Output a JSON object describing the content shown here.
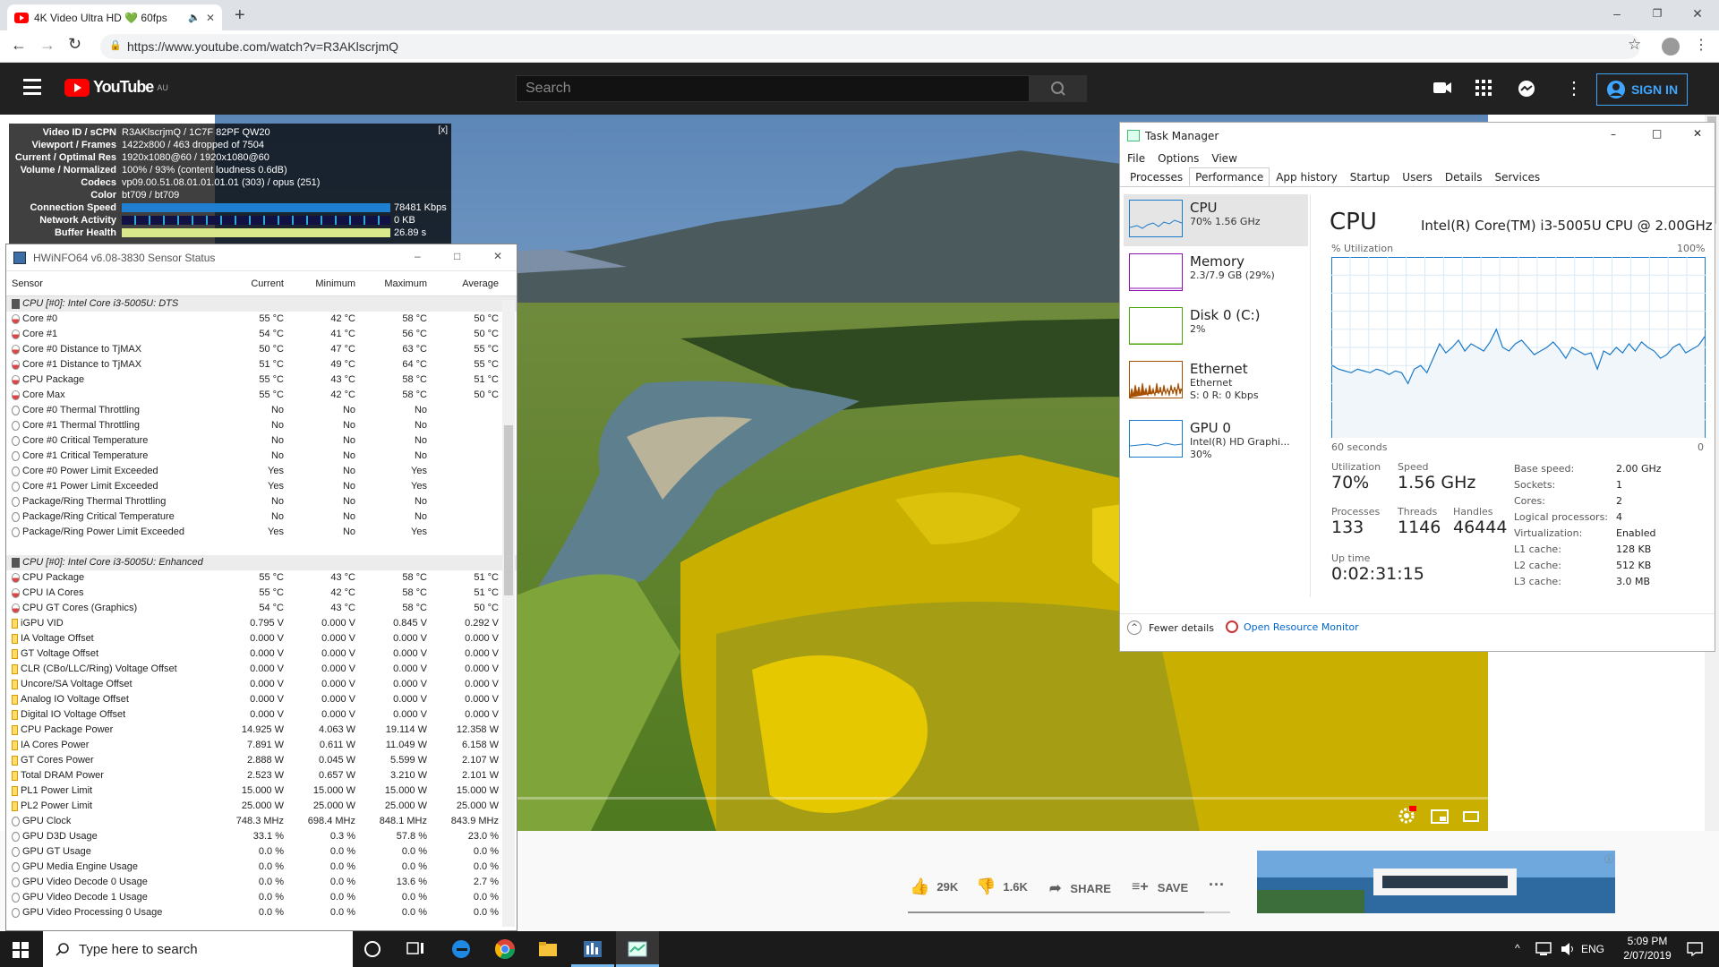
{
  "browser": {
    "tab_title": "4K Video Ultra HD 💚 60fps",
    "url": "https://www.youtube.com/watch?v=R3AKlscrjmQ"
  },
  "youtube": {
    "logo": "YouTube",
    "region": "AU",
    "search_placeholder": "Search",
    "signin_label": "SIGN IN",
    "likes": "29K",
    "dislikes": "1.6K",
    "share_label": "SHARE",
    "save_label": "SAVE"
  },
  "stats_for_nerds": {
    "close": "[x]",
    "rows": [
      {
        "k": "Video ID / sCPN",
        "v": "R3AKlscrjmQ / 1C7F 82PF QW20"
      },
      {
        "k": "Viewport / Frames",
        "v": "1422x800 / 463 dropped of 7504"
      },
      {
        "k": "Current / Optimal Res",
        "v": "1920x1080@60 / 1920x1080@60"
      },
      {
        "k": "Volume / Normalized",
        "v": "100% / 93% (content loudness 0.6dB)"
      },
      {
        "k": "Codecs",
        "v": "vp09.00.51.08.01.01.01.01 (303) / opus (251)"
      },
      {
        "k": "Color",
        "v": "bt709 / bt709"
      },
      {
        "k": "Connection Speed",
        "v": "78481 Kbps"
      },
      {
        "k": "Network Activity",
        "v": "0 KB"
      },
      {
        "k": "Buffer Health",
        "v": "26.89 s"
      }
    ]
  },
  "hwinfo": {
    "title": "HWiNFO64 v6.08-3830 Sensor Status",
    "headers": [
      "Sensor",
      "Current",
      "Minimum",
      "Maximum",
      "Average"
    ],
    "rows": [
      {
        "grp": true,
        "n": "CPU [#0]: Intel Core i3-5005U: DTS"
      },
      {
        "i": "t",
        "n": "Core #0",
        "c": "55 °C",
        "mn": "42 °C",
        "mx": "58 °C",
        "av": "50 °C"
      },
      {
        "i": "t",
        "n": "Core #1",
        "c": "54 °C",
        "mn": "41 °C",
        "mx": "56 °C",
        "av": "50 °C"
      },
      {
        "i": "t",
        "n": "Core #0 Distance to TjMAX",
        "c": "50 °C",
        "mn": "47 °C",
        "mx": "63 °C",
        "av": "55 °C"
      },
      {
        "i": "t",
        "n": "Core #1 Distance to TjMAX",
        "c": "51 °C",
        "mn": "49 °C",
        "mx": "64 °C",
        "av": "55 °C"
      },
      {
        "i": "t",
        "n": "CPU Package",
        "c": "55 °C",
        "mn": "43 °C",
        "mx": "58 °C",
        "av": "51 °C"
      },
      {
        "i": "t",
        "n": "Core Max",
        "c": "55 °C",
        "mn": "42 °C",
        "mx": "58 °C",
        "av": "50 °C"
      },
      {
        "i": "o",
        "n": "Core #0 Thermal Throttling",
        "c": "No",
        "mn": "No",
        "mx": "No",
        "av": ""
      },
      {
        "i": "o",
        "n": "Core #1 Thermal Throttling",
        "c": "No",
        "mn": "No",
        "mx": "No",
        "av": ""
      },
      {
        "i": "o",
        "n": "Core #0 Critical Temperature",
        "c": "No",
        "mn": "No",
        "mx": "No",
        "av": ""
      },
      {
        "i": "o",
        "n": "Core #1 Critical Temperature",
        "c": "No",
        "mn": "No",
        "mx": "No",
        "av": ""
      },
      {
        "i": "o",
        "n": "Core #0 Power Limit Exceeded",
        "c": "Yes",
        "mn": "No",
        "mx": "Yes",
        "av": ""
      },
      {
        "i": "o",
        "n": "Core #1 Power Limit Exceeded",
        "c": "Yes",
        "mn": "No",
        "mx": "Yes",
        "av": ""
      },
      {
        "i": "o",
        "n": "Package/Ring Thermal Throttling",
        "c": "No",
        "mn": "No",
        "mx": "No",
        "av": ""
      },
      {
        "i": "o",
        "n": "Package/Ring Critical Temperature",
        "c": "No",
        "mn": "No",
        "mx": "No",
        "av": ""
      },
      {
        "i": "o",
        "n": "Package/Ring Power Limit Exceeded",
        "c": "Yes",
        "mn": "No",
        "mx": "Yes",
        "av": ""
      },
      {
        "blank": true
      },
      {
        "grp": true,
        "n": "CPU [#0]: Intel Core i3-5005U: Enhanced"
      },
      {
        "i": "t",
        "n": "CPU Package",
        "c": "55 °C",
        "mn": "43 °C",
        "mx": "58 °C",
        "av": "51 °C"
      },
      {
        "i": "t",
        "n": "CPU IA Cores",
        "c": "55 °C",
        "mn": "42 °C",
        "mx": "58 °C",
        "av": "51 °C"
      },
      {
        "i": "t",
        "n": "CPU GT Cores (Graphics)",
        "c": "54 °C",
        "mn": "43 °C",
        "mx": "58 °C",
        "av": "50 °C"
      },
      {
        "i": "v",
        "n": "iGPU VID",
        "c": "0.795 V",
        "mn": "0.000 V",
        "mx": "0.845 V",
        "av": "0.292 V"
      },
      {
        "i": "v",
        "n": "IA Voltage Offset",
        "c": "0.000 V",
        "mn": "0.000 V",
        "mx": "0.000 V",
        "av": "0.000 V"
      },
      {
        "i": "v",
        "n": "GT Voltage Offset",
        "c": "0.000 V",
        "mn": "0.000 V",
        "mx": "0.000 V",
        "av": "0.000 V"
      },
      {
        "i": "v",
        "n": "CLR (CBo/LLC/Ring) Voltage Offset",
        "c": "0.000 V",
        "mn": "0.000 V",
        "mx": "0.000 V",
        "av": "0.000 V"
      },
      {
        "i": "v",
        "n": "Uncore/SA Voltage Offset",
        "c": "0.000 V",
        "mn": "0.000 V",
        "mx": "0.000 V",
        "av": "0.000 V"
      },
      {
        "i": "v",
        "n": "Analog IO Voltage Offset",
        "c": "0.000 V",
        "mn": "0.000 V",
        "mx": "0.000 V",
        "av": "0.000 V"
      },
      {
        "i": "v",
        "n": "Digital IO Voltage Offset",
        "c": "0.000 V",
        "mn": "0.000 V",
        "mx": "0.000 V",
        "av": "0.000 V"
      },
      {
        "i": "v",
        "n": "CPU Package Power",
        "c": "14.925 W",
        "mn": "4.063 W",
        "mx": "19.114 W",
        "av": "12.358 W"
      },
      {
        "i": "v",
        "n": "IA Cores Power",
        "c": "7.891 W",
        "mn": "0.611 W",
        "mx": "11.049 W",
        "av": "6.158 W"
      },
      {
        "i": "v",
        "n": "GT Cores Power",
        "c": "2.888 W",
        "mn": "0.045 W",
        "mx": "5.599 W",
        "av": "2.107 W"
      },
      {
        "i": "v",
        "n": "Total DRAM Power",
        "c": "2.523 W",
        "mn": "0.657 W",
        "mx": "3.210 W",
        "av": "2.101 W"
      },
      {
        "i": "v",
        "n": "PL1 Power Limit",
        "c": "15.000 W",
        "mn": "15.000 W",
        "mx": "15.000 W",
        "av": "15.000 W"
      },
      {
        "i": "v",
        "n": "PL2 Power Limit",
        "c": "25.000 W",
        "mn": "25.000 W",
        "mx": "25.000 W",
        "av": "25.000 W"
      },
      {
        "i": "o",
        "n": "GPU Clock",
        "c": "748.3 MHz",
        "mn": "698.4 MHz",
        "mx": "848.1 MHz",
        "av": "843.9 MHz"
      },
      {
        "i": "o",
        "n": "GPU D3D Usage",
        "c": "33.1 %",
        "mn": "0.3 %",
        "mx": "57.8 %",
        "av": "23.0 %"
      },
      {
        "i": "o",
        "n": "GPU GT Usage",
        "c": "0.0 %",
        "mn": "0.0 %",
        "mx": "0.0 %",
        "av": "0.0 %"
      },
      {
        "i": "o",
        "n": "GPU Media Engine Usage",
        "c": "0.0 %",
        "mn": "0.0 %",
        "mx": "0.0 %",
        "av": "0.0 %"
      },
      {
        "i": "o",
        "n": "GPU Video Decode 0 Usage",
        "c": "0.0 %",
        "mn": "0.0 %",
        "mx": "13.6 %",
        "av": "2.7 %"
      },
      {
        "i": "o",
        "n": "GPU Video Decode 1 Usage",
        "c": "0.0 %",
        "mn": "0.0 %",
        "mx": "0.0 %",
        "av": "0.0 %"
      },
      {
        "i": "o",
        "n": "GPU Video Processing 0 Usage",
        "c": "0.0 %",
        "mn": "0.0 %",
        "mx": "0.0 %",
        "av": "0.0 %"
      }
    ]
  },
  "taskmgr": {
    "title": "Task Manager",
    "menu": [
      "File",
      "Options",
      "View"
    ],
    "tabs": [
      "Processes",
      "Performance",
      "App history",
      "Startup",
      "Users",
      "Details",
      "Services"
    ],
    "items": [
      {
        "name": "CPU",
        "sub1": "70%  1.56 GHz",
        "sub2": "",
        "sub3": "",
        "color": "#1979ca"
      },
      {
        "name": "Memory",
        "sub1": "2.3/7.9 GB (29%)",
        "sub2": "",
        "sub3": "",
        "color": "#8b12ae"
      },
      {
        "name": "Disk 0 (C:)",
        "sub1": "2%",
        "sub2": "",
        "sub3": "",
        "color": "#4da60c"
      },
      {
        "name": "Ethernet",
        "sub1": "Ethernet",
        "sub2": "S: 0 R: 0 Kbps",
        "sub3": "",
        "color": "#a74f01"
      },
      {
        "name": "GPU 0",
        "sub1": "Intel(R) HD Graphi...",
        "sub2": "30%",
        "sub3": "",
        "color": "#1979ca"
      }
    ],
    "heading": "CPU",
    "model": "Intel(R) Core(TM) i3-5005U CPU @ 2.00GHz",
    "util_label": "% Utilization",
    "max_label": "100%",
    "time_label": "60 seconds",
    "min_label": "0",
    "stats": {
      "utilization_l": "Utilization",
      "utilization": "70%",
      "speed_l": "Speed",
      "speed": "1.56 GHz",
      "processes_l": "Processes",
      "processes": "133",
      "threads_l": "Threads",
      "threads": "1146",
      "handles_l": "Handles",
      "handles": "46444",
      "uptime_l": "Up time",
      "uptime": "0:02:31:15"
    },
    "specs": [
      {
        "k": "Base speed:",
        "v": "2.00 GHz"
      },
      {
        "k": "Sockets:",
        "v": "1"
      },
      {
        "k": "Cores:",
        "v": "2"
      },
      {
        "k": "Logical processors:",
        "v": "4"
      },
      {
        "k": "Virtualization:",
        "v": "Enabled"
      },
      {
        "k": "L1 cache:",
        "v": "128 KB"
      },
      {
        "k": "L2 cache:",
        "v": "512 KB"
      },
      {
        "k": "L3 cache:",
        "v": "3.0 MB"
      }
    ],
    "fewer_details": "Fewer details",
    "open_resmon": "Open Resource Monitor"
  },
  "chart_data": {
    "type": "line",
    "title": "",
    "xlabel": "60 seconds",
    "ylabel": "% Utilization",
    "ylim": [
      0,
      100
    ],
    "series": [
      {
        "values": [
          40,
          38,
          37,
          36,
          38,
          37,
          36,
          38,
          37,
          35,
          37,
          36,
          30,
          38,
          40,
          36,
          44,
          52,
          47,
          50,
          54,
          48,
          52,
          50,
          48,
          53,
          60,
          50,
          48,
          52,
          54,
          50,
          46,
          48,
          50,
          53,
          49,
          44,
          50,
          48,
          46,
          47,
          38,
          48,
          46,
          50,
          47,
          52,
          48,
          53,
          50,
          48,
          44,
          46,
          50,
          52,
          47,
          49,
          51,
          56
        ]
      }
    ]
  },
  "taskbar": {
    "search": "Type here to search",
    "lang": "ENG",
    "time": "5:09 PM",
    "date": "2/07/2019"
  }
}
